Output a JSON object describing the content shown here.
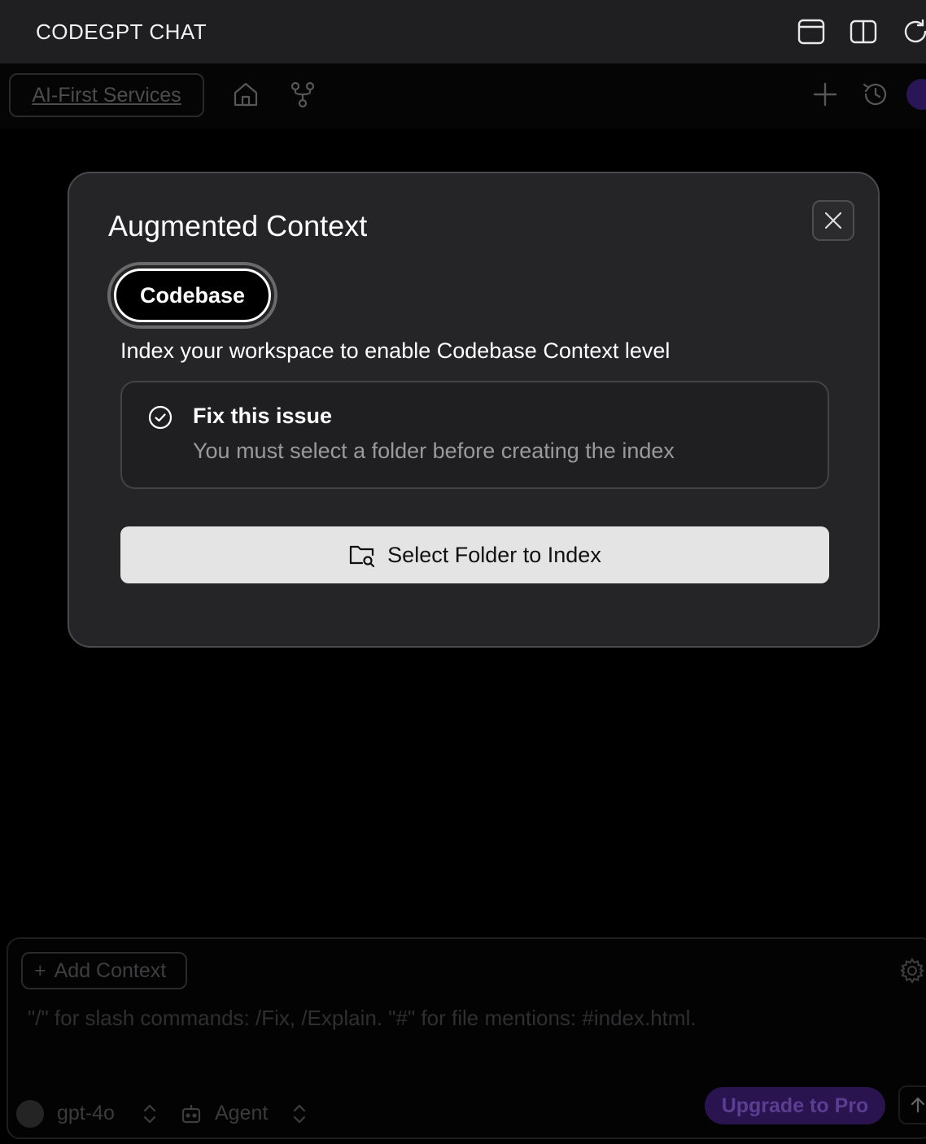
{
  "titlebar": {
    "title": "CODEGPT CHAT",
    "icons": [
      "panel-icon",
      "split-view-icon",
      "refresh-icon"
    ]
  },
  "toolbar": {
    "project": "AI-First Services",
    "icons": [
      "home-icon",
      "branch-icon",
      "plus-icon",
      "history-icon",
      "avatar"
    ]
  },
  "modal": {
    "title": "Augmented Context",
    "tab_label": "Codebase",
    "description": "Index your workspace to enable Codebase Context level",
    "issue": {
      "title": "Fix this issue",
      "text": "You must select a folder before creating the index"
    },
    "select_button_label": "Select Folder to Index"
  },
  "composer": {
    "add_context_label": "Add Context",
    "placeholder": "\"/\" for slash commands: /Fix, /Explain. \"#\" for file mentions: #index.html.",
    "model": "gpt-4o",
    "mode": "Agent",
    "upgrade_label": "Upgrade to Pro"
  },
  "colors": {
    "background": "#000000",
    "modal_bg": "#252527",
    "accent_purple": "#2a1450",
    "button_light": "#e4e4e4"
  }
}
